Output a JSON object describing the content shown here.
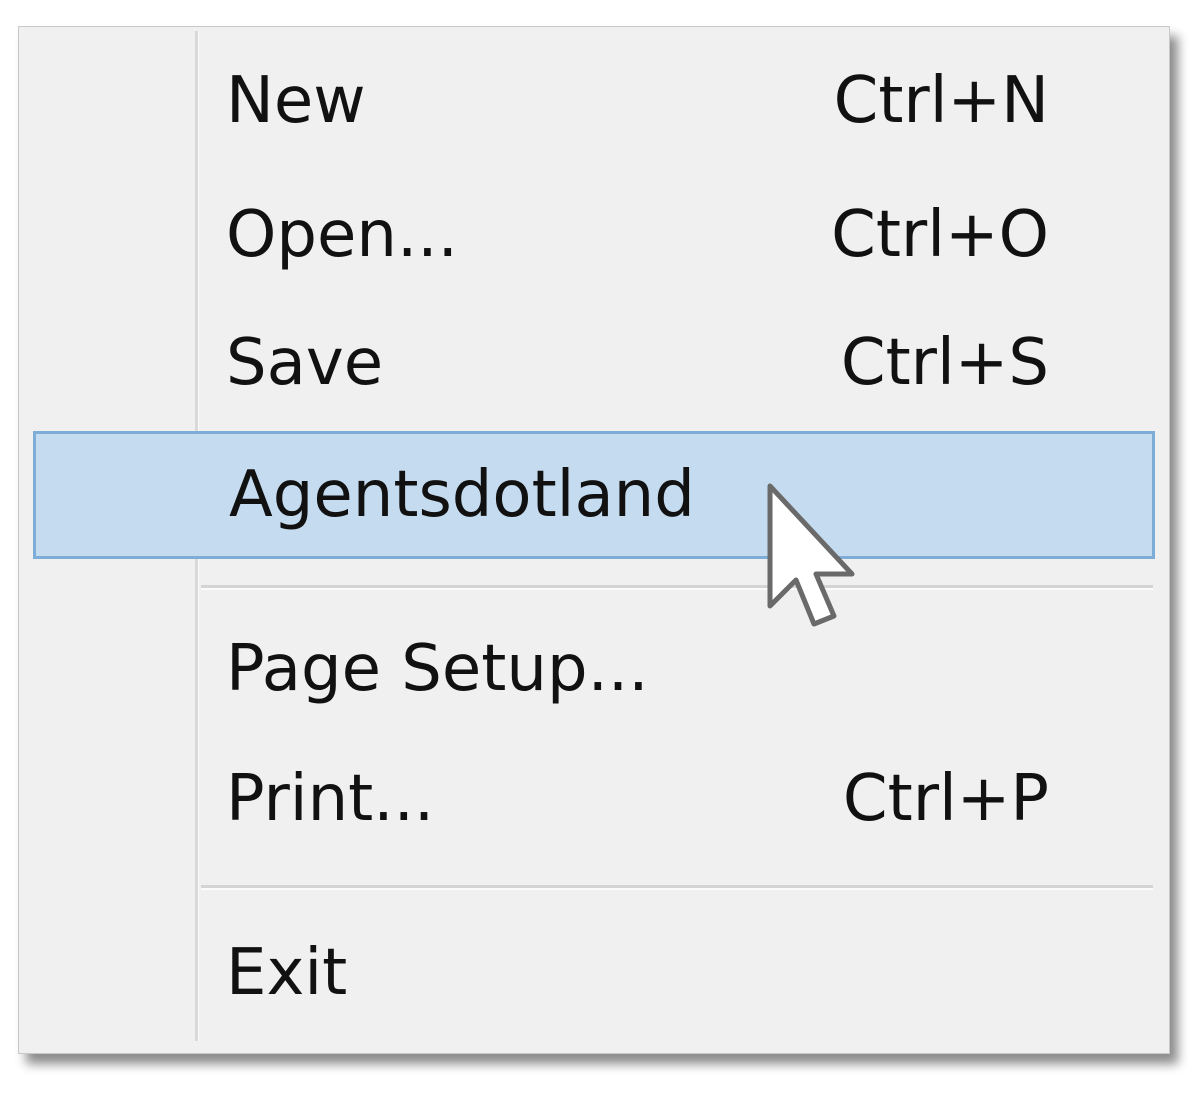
{
  "menu": {
    "items": [
      {
        "label": "New",
        "shortcut": "Ctrl+N"
      },
      {
        "label": "Open...",
        "shortcut": "Ctrl+O"
      },
      {
        "label": "Save",
        "shortcut": "Ctrl+S"
      },
      {
        "label": "Agentsdotland",
        "shortcut": "",
        "highlighted": true
      },
      {
        "label": "Page Setup...",
        "shortcut": ""
      },
      {
        "label": "Print...",
        "shortcut": "Ctrl+P"
      },
      {
        "label": "Exit",
        "shortcut": ""
      }
    ]
  },
  "colors": {
    "menu_background": "#f0f0f0",
    "highlight_fill": "#c5dcf0",
    "highlight_border": "#7eaed8"
  },
  "icons": {
    "cursor": "arrow-pointer-icon"
  }
}
